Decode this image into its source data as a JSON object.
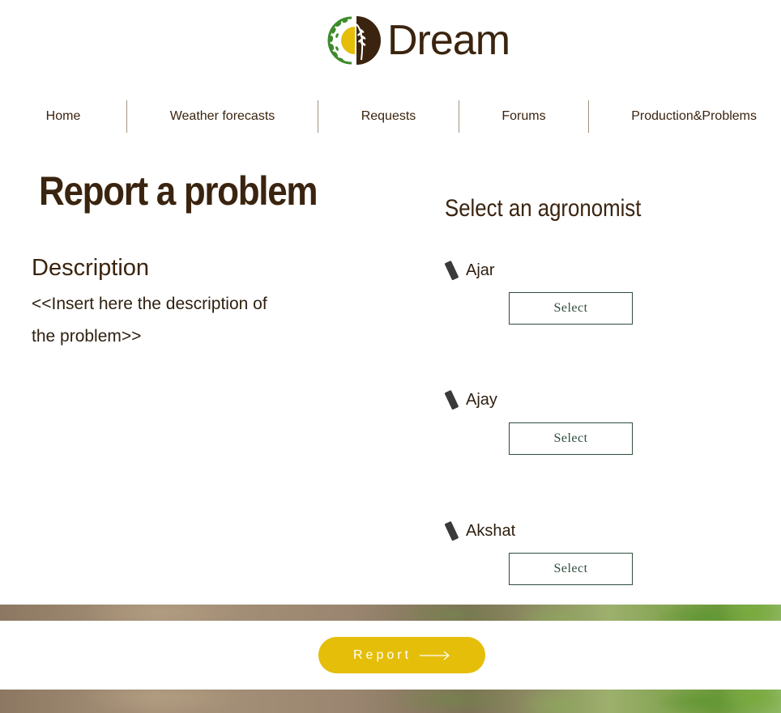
{
  "logo": {
    "text": "Dream",
    "icon": "wheat-logo-icon",
    "colors": {
      "brown": "#3b240f",
      "yellow": "#e5be0a",
      "green": "#3e8a2b"
    }
  },
  "nav": {
    "items": [
      {
        "label": "Home"
      },
      {
        "label": "Weather forecasts"
      },
      {
        "label": "Requests"
      },
      {
        "label": "Forums"
      },
      {
        "label": "Production&Problems"
      }
    ]
  },
  "report": {
    "title": "Report a problem",
    "description_heading": "Description",
    "description_placeholder": "<<Insert here the description of the problem>>"
  },
  "agronomists": {
    "heading": "Select an agronomist",
    "items": [
      {
        "name": "Ajar",
        "button_label": "Select",
        "icon": "phone-icon"
      },
      {
        "name": "Ajay",
        "button_label": "Select",
        "icon": "phone-icon"
      },
      {
        "name": "Akshat",
        "button_label": "Select",
        "icon": "phone-icon"
      }
    ]
  },
  "submit": {
    "label": "Report",
    "icon": "arrow-right-icon",
    "color": "#e5be0a"
  }
}
